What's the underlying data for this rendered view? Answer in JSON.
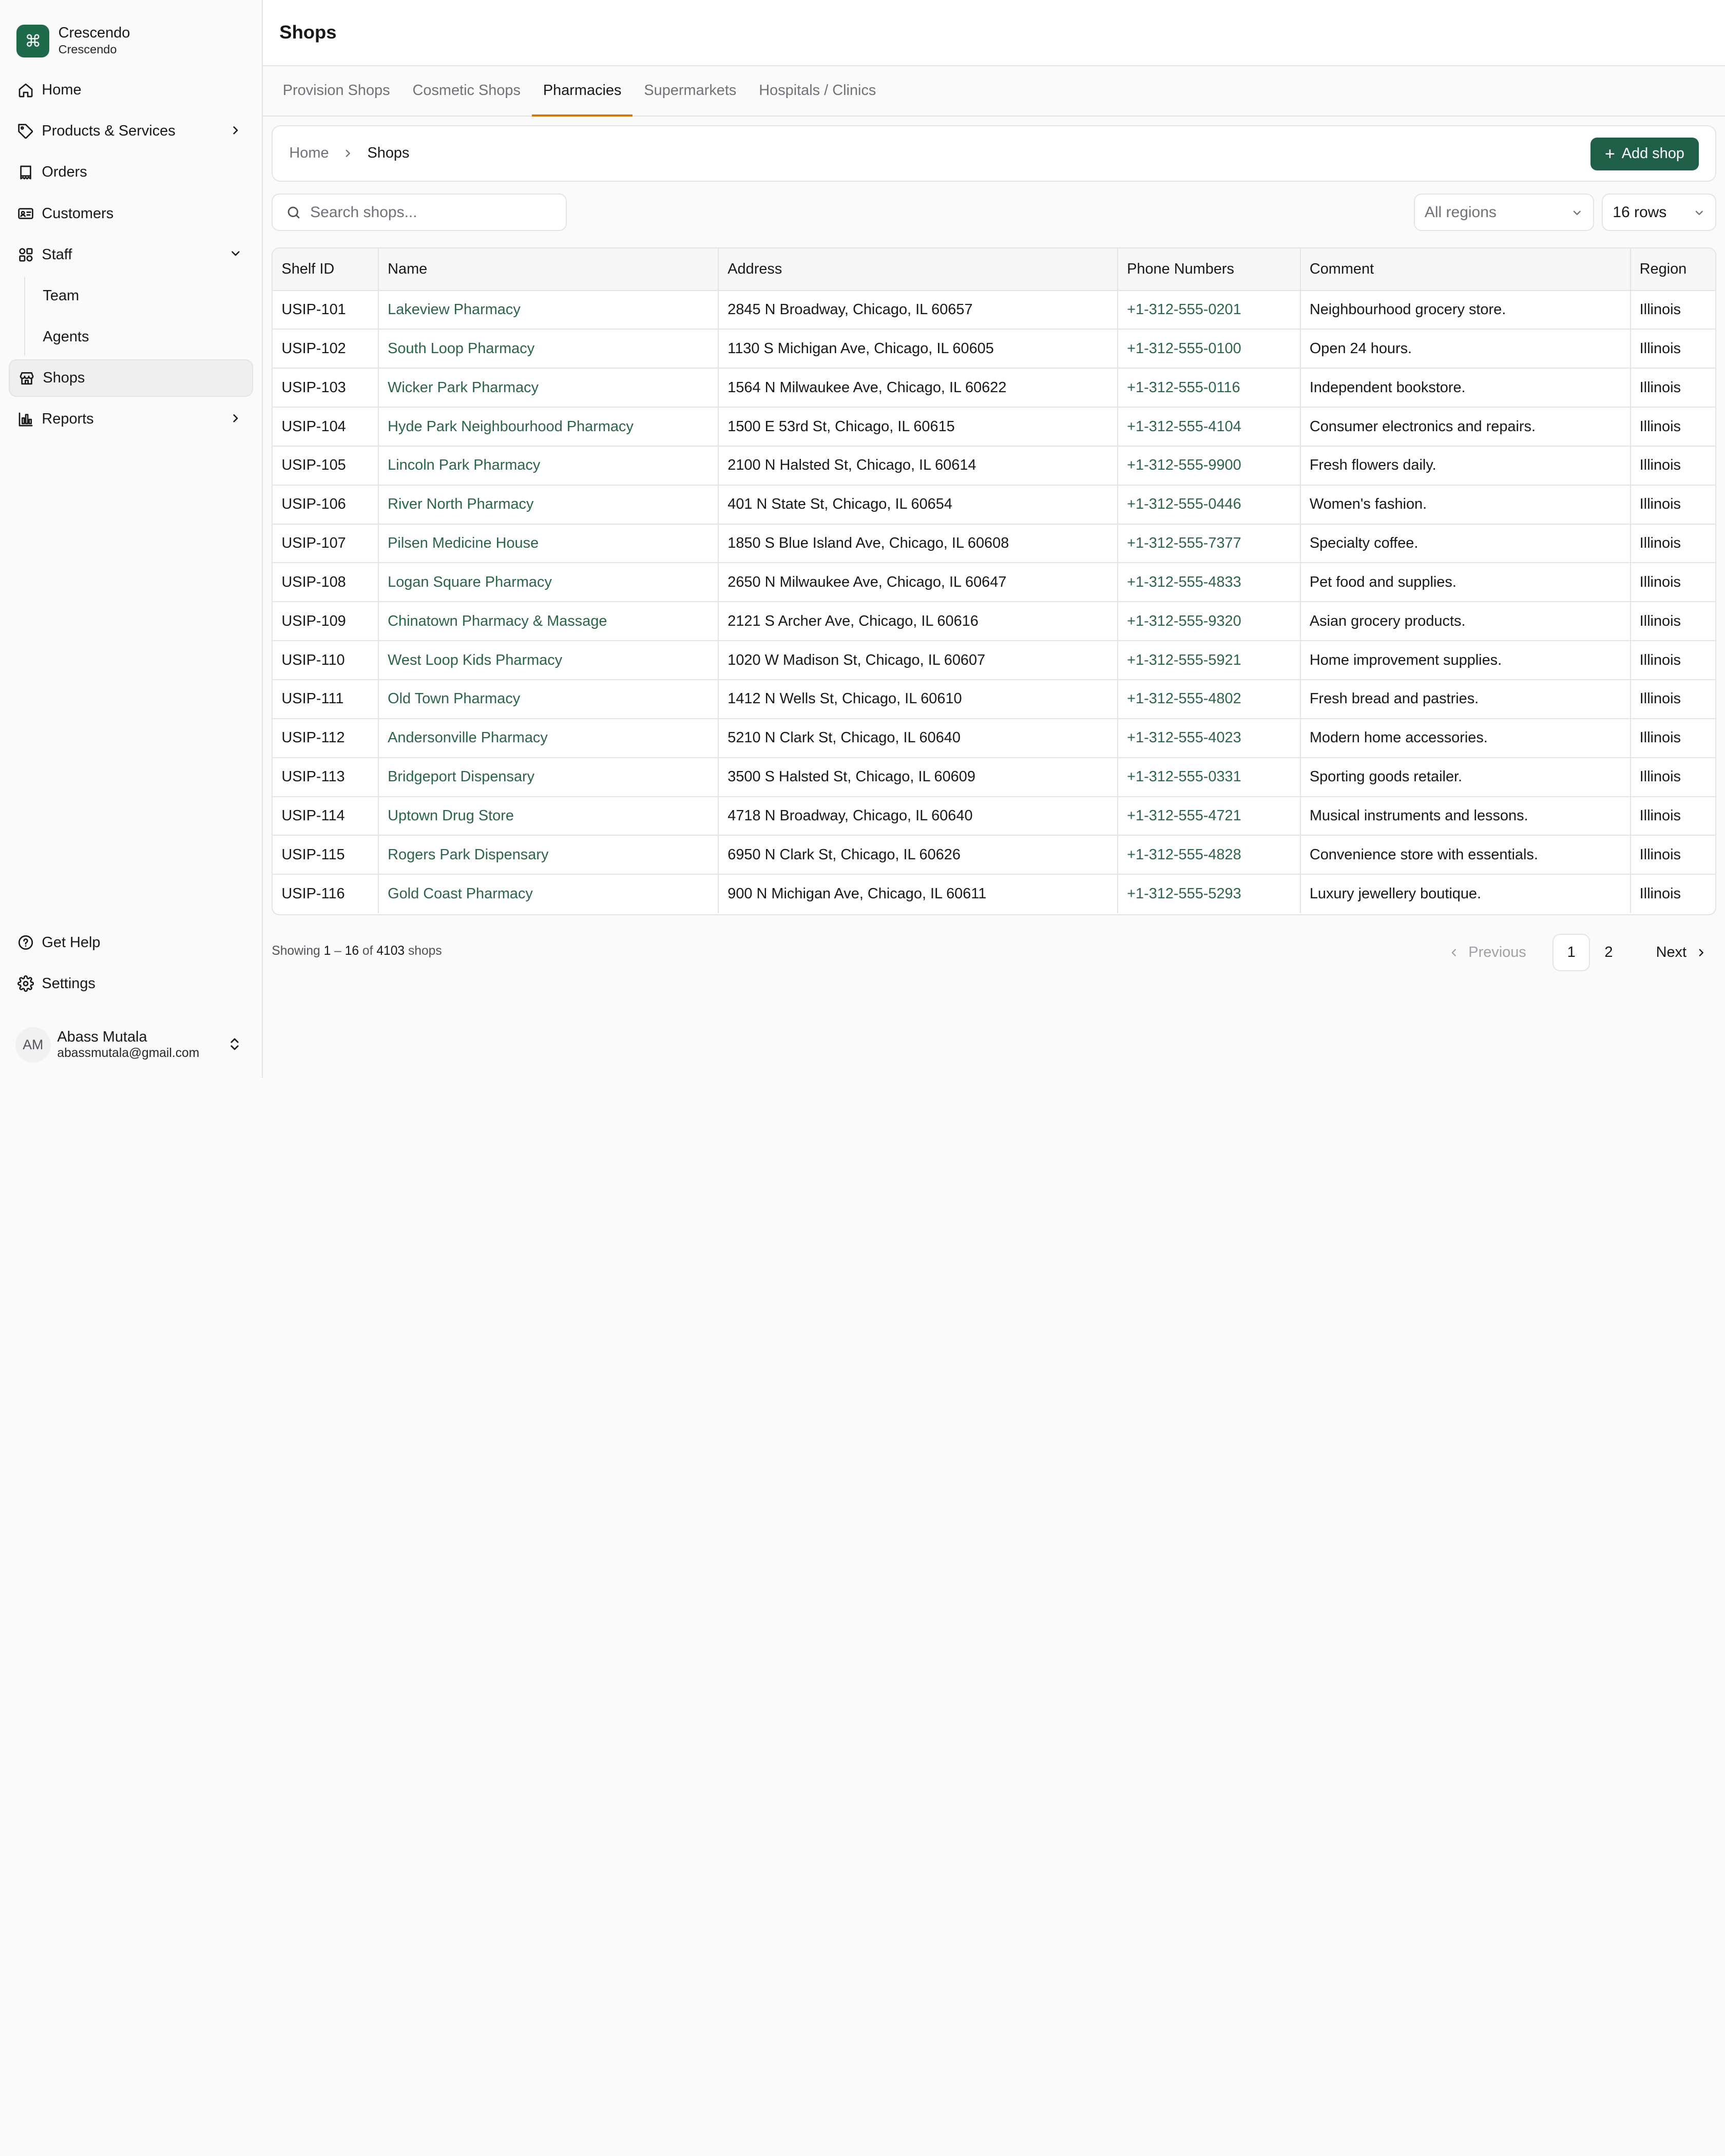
{
  "brand": {
    "name": "Crescendo",
    "subtitle": "Crescendo",
    "logo_glyph": "⌘"
  },
  "sidebar": {
    "items": [
      {
        "label": "Home",
        "icon": "home-icon"
      },
      {
        "label": "Products & Services",
        "icon": "tag-icon"
      },
      {
        "label": "Orders",
        "icon": "orders-icon"
      },
      {
        "label": "Customers",
        "icon": "id-card-icon"
      },
      {
        "label": "Staff",
        "icon": "grid-icon"
      }
    ],
    "staff_sub": [
      "Team",
      "Agents"
    ],
    "shops": {
      "label": "Shops",
      "icon": "store-icon"
    },
    "reports": {
      "label": "Reports",
      "icon": "bar-chart-icon"
    },
    "bottom": [
      {
        "label": "Get Help",
        "icon": "help-icon"
      },
      {
        "label": "Settings",
        "icon": "gear-icon"
      }
    ]
  },
  "user": {
    "initials": "AM",
    "name": "Abass Mutala",
    "email": "abassmutala@gmail.com"
  },
  "header": {
    "title": "Shops"
  },
  "tabs": [
    "Provision Shops",
    "Cosmetic Shops",
    "Pharmacies",
    "Supermarkets",
    "Hospitals / Clinics"
  ],
  "active_tab": "Pharmacies",
  "breadcrumb": {
    "home": "Home",
    "current": "Shops"
  },
  "add_button": "Add shop",
  "search": {
    "placeholder": "Search shops..."
  },
  "filters": {
    "region": "All regions",
    "rows": "16 rows"
  },
  "table": {
    "columns": [
      "Shelf ID",
      "Name",
      "Address",
      "Phone Numbers",
      "Comment",
      "Region"
    ],
    "rows": [
      [
        "USIP-101",
        "Lakeview Pharmacy",
        "2845 N Broadway, Chicago, IL 60657",
        "+1-312-555-0201",
        "Neighbourhood grocery store.",
        "Illinois"
      ],
      [
        "USIP-102",
        "South Loop Pharmacy",
        "1130 S Michigan Ave, Chicago, IL 60605",
        "+1-312-555-0100",
        "Open 24 hours.",
        "Illinois"
      ],
      [
        "USIP-103",
        "Wicker Park Pharmacy",
        "1564 N Milwaukee Ave, Chicago, IL 60622",
        "+1-312-555-0116",
        "Independent bookstore.",
        "Illinois"
      ],
      [
        "USIP-104",
        "Hyde Park Neighbourhood Pharmacy",
        "1500 E 53rd St, Chicago, IL 60615",
        "+1-312-555-4104",
        "Consumer electronics and repairs.",
        "Illinois"
      ],
      [
        "USIP-105",
        "Lincoln Park Pharmacy",
        "2100 N Halsted St, Chicago, IL 60614",
        "+1-312-555-9900",
        "Fresh flowers daily.",
        "Illinois"
      ],
      [
        "USIP-106",
        "River North Pharmacy",
        "401 N State St, Chicago, IL 60654",
        "+1-312-555-0446",
        "Women's fashion.",
        "Illinois"
      ],
      [
        "USIP-107",
        "Pilsen Medicine House",
        "1850 S Blue Island Ave, Chicago, IL 60608",
        "+1-312-555-7377",
        "Specialty coffee.",
        "Illinois"
      ],
      [
        "USIP-108",
        "Logan Square Pharmacy",
        "2650 N Milwaukee Ave, Chicago, IL 60647",
        "+1-312-555-4833",
        "Pet food and supplies.",
        "Illinois"
      ],
      [
        "USIP-109",
        "Chinatown Pharmacy & Massage",
        "2121 S Archer Ave, Chicago, IL 60616",
        "+1-312-555-9320",
        "Asian grocery products.",
        "Illinois"
      ],
      [
        "USIP-110",
        "West Loop Kids Pharmacy",
        "1020 W Madison St, Chicago, IL 60607",
        "+1-312-555-5921",
        "Home improvement supplies.",
        "Illinois"
      ],
      [
        "USIP-111",
        "Old Town Pharmacy",
        "1412 N Wells St, Chicago, IL 60610",
        "+1-312-555-4802",
        "Fresh bread and pastries.",
        "Illinois"
      ],
      [
        "USIP-112",
        "Andersonville Pharmacy",
        "5210 N Clark St, Chicago, IL 60640",
        "+1-312-555-4023",
        "Modern home accessories.",
        "Illinois"
      ],
      [
        "USIP-113",
        "Bridgeport Dispensary",
        "3500 S Halsted St, Chicago, IL 60609",
        "+1-312-555-0331",
        "Sporting goods retailer.",
        "Illinois"
      ],
      [
        "USIP-114",
        "Uptown Drug Store",
        "4718 N Broadway, Chicago, IL 60640",
        "+1-312-555-4721",
        "Musical instruments and lessons.",
        "Illinois"
      ],
      [
        "USIP-115",
        "Rogers Park Dispensary",
        "6950 N Clark St, Chicago, IL 60626",
        "+1-312-555-4828",
        "Convenience store with essentials.",
        "Illinois"
      ],
      [
        "USIP-116",
        "Gold Coast Pharmacy",
        "900 N Michigan Ave, Chicago, IL 60611",
        "+1-312-555-5293",
        "Luxury jewellery boutique.",
        "Illinois"
      ]
    ]
  },
  "footer": {
    "showing_prefix": "Showing",
    "range_start": "1",
    "range_sep": "–",
    "range_end": "16",
    "of": "of",
    "total": "4103",
    "unit": "shops"
  },
  "pagination": {
    "previous": "Previous",
    "pages": [
      "1",
      "2"
    ],
    "current": "1",
    "next": "Next"
  },
  "colors": {
    "brand": "#1f6a4a",
    "accent_tab": "#d97706",
    "link": "#2b6548"
  }
}
